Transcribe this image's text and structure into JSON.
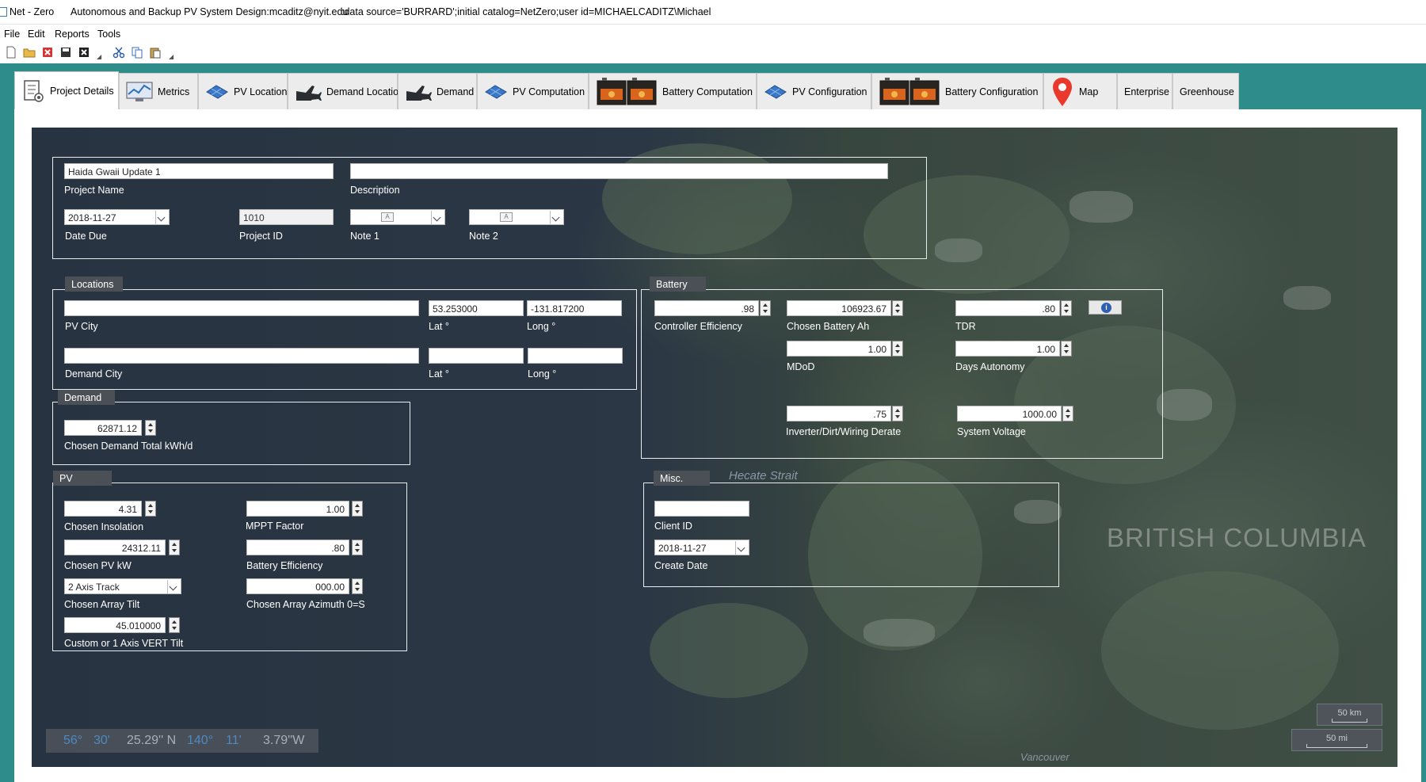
{
  "window": {
    "app_name": "Net - Zero",
    "subtitle": "Autonomous and Backup PV System Design:mcaditz@nyit.edu",
    "connection": ":data source='BURRARD';initial catalog=NetZero;user id=MICHAELCADITZ\\Michael"
  },
  "menu": [
    "File",
    "Edit",
    "Reports",
    "Tools"
  ],
  "toolbar_icons": [
    "new-icon",
    "open-folder-icon",
    "delete-icon",
    "save-icon",
    "close-icon",
    "cut-icon",
    "copy-icon",
    "paste-icon"
  ],
  "tabs": [
    {
      "label": "Project Details",
      "icon": "project-details-icon",
      "active": true
    },
    {
      "label": "Metrics",
      "icon": "metrics-icon"
    },
    {
      "label": "PV Location",
      "icon": "solar-panel-icon"
    },
    {
      "label": "Demand Location",
      "icon": "aircraft-icon"
    },
    {
      "label": "Demand",
      "icon": "aircraft-icon"
    },
    {
      "label": "PV Computation",
      "icon": "solar-panel-icon"
    },
    {
      "label": "Battery Computation",
      "icon": "battery-icon"
    },
    {
      "label": "PV Configuration",
      "icon": "solar-panel-icon"
    },
    {
      "label": "Battery Configuration",
      "icon": "battery-icon"
    },
    {
      "label": "Map",
      "icon": "map-pin-icon"
    },
    {
      "label": "Enterprise"
    },
    {
      "label": "Greenhouse"
    }
  ],
  "project": {
    "name_value": "Haida Gwaii Update 1",
    "name_label": "Project Name",
    "description_value": "",
    "description_label": "Description",
    "date_due_value": "2018-11-27",
    "date_due_label": "Date Due",
    "project_id_value": "1010",
    "project_id_label": "Project ID",
    "note1_label": "Note 1",
    "note2_label": "Note 2"
  },
  "locations": {
    "title": "Locations",
    "pv_city_value": "",
    "pv_city_label": "PV City",
    "pv_lat_value": "53.253000",
    "pv_long_value": "-131.817200",
    "demand_city_value": "",
    "demand_city_label": "Demand City",
    "demand_lat_value": "",
    "demand_long_value": "",
    "lat_label": "Lat °",
    "long_label": "Long °"
  },
  "demand": {
    "title": "Demand",
    "total_value": "62871.12",
    "total_label": "Chosen Demand Total kWh/d"
  },
  "pv": {
    "title": "PV",
    "insolation_value": "4.31",
    "insolation_label": "Chosen Insolation",
    "mppt_value": "1.00",
    "mppt_label": "MPPT Factor",
    "pv_kw_value": "24312.11",
    "pv_kw_label": "Chosen PV kW",
    "battery_eff_value": ".80",
    "battery_eff_label": "Battery Efficiency",
    "array_tilt_value": "2 Axis Track",
    "array_tilt_label": "Chosen Array Tilt",
    "azimuth_value": "000.00",
    "azimuth_label": "Chosen Array Azimuth 0=S",
    "vert_tilt_value": "45.010000",
    "vert_tilt_label": "Custom or 1 Axis  VERT Tilt"
  },
  "battery": {
    "title": "Battery",
    "controller_eff_value": ".98",
    "controller_eff_label": "Controller Efficiency",
    "battery_ah_value": "106923.67",
    "battery_ah_label": "Chosen Battery Ah",
    "tdr_value": ".80",
    "tdr_label": "TDR",
    "mdod_value": "1.00",
    "mdod_label": "MDoD",
    "days_autonomy_value": "1.00",
    "days_autonomy_label": "Days Autonomy",
    "derate_value": ".75",
    "derate_label": "Inverter/Dirt/Wiring Derate",
    "system_voltage_value": "1000.00",
    "system_voltage_label": "System Voltage"
  },
  "misc": {
    "title": "Misc.",
    "client_id_value": "",
    "client_id_label": "Client ID",
    "create_date_value": "2018-11-27",
    "create_date_label": "Create Date"
  },
  "map": {
    "labels": {
      "strait": "Hecate Strait",
      "province": "BRITISH COLUMBIA",
      "city": "Vancouver"
    },
    "coords": {
      "lat_deg": "56°",
      "lat_min": "30'",
      "lat_sec": "25.29'' N",
      "lon_deg": "140°",
      "lon_min": "11'",
      "lon_sec": "3.79''W"
    },
    "scale_km": "50 km",
    "scale_mi": "50 mi"
  },
  "colors": {
    "teal_background": "#2e8d8a",
    "group_label": "#4b5057",
    "map_water": "#2b3744",
    "map_land": "#404f45"
  }
}
